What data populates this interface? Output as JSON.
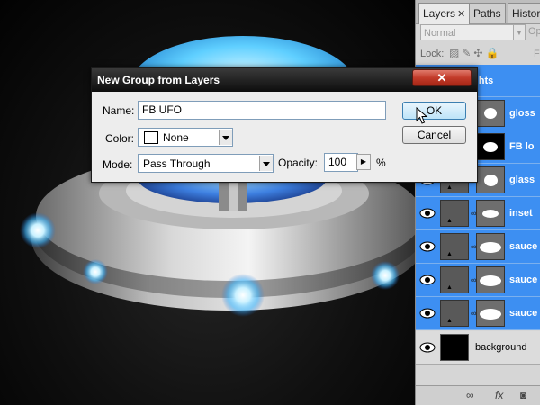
{
  "dialog": {
    "title": "New Group from Layers",
    "close_glyph": "✕",
    "name_label": "Name:",
    "name_value": "FB UFO",
    "color_label": "Color:",
    "color_value": "None",
    "mode_label": "Mode:",
    "mode_value": "Pass Through",
    "opacity_label": "Opacity:",
    "opacity_value": "100",
    "opacity_unit": "%",
    "ok_label": "OK",
    "cancel_label": "Cancel"
  },
  "panel": {
    "tabs": [
      {
        "label": "Layers",
        "close": "✕"
      },
      {
        "label": "Paths"
      },
      {
        "label": "History"
      }
    ],
    "blend_mode": "Normal",
    "opacity_label": "Opaci",
    "lock_label": "Lock:",
    "fill_label": "F",
    "layers": [
      {
        "name": "ights",
        "selected": true
      },
      {
        "name": "gloss",
        "selected": true,
        "mask": "gray"
      },
      {
        "name": "FB lo",
        "selected": true,
        "mask": "black"
      },
      {
        "name": "glass",
        "selected": true,
        "mask": "gray"
      },
      {
        "name": "inset",
        "selected": true,
        "mask": "gray"
      },
      {
        "name": "sauce",
        "selected": true,
        "mask": "gray"
      },
      {
        "name": "sauce",
        "selected": true,
        "mask": "gray"
      },
      {
        "name": "sauce",
        "selected": true,
        "mask": "gray"
      },
      {
        "name": "background",
        "selected": false
      }
    ],
    "bottom_icons": [
      "link-icon",
      "fx-icon",
      "mask-icon"
    ],
    "fx_label": "fx"
  },
  "colors": {
    "selection": "#3d8ff2",
    "ufo_glow": "#6fd4ff",
    "title_bar": "#0d0d0d"
  }
}
